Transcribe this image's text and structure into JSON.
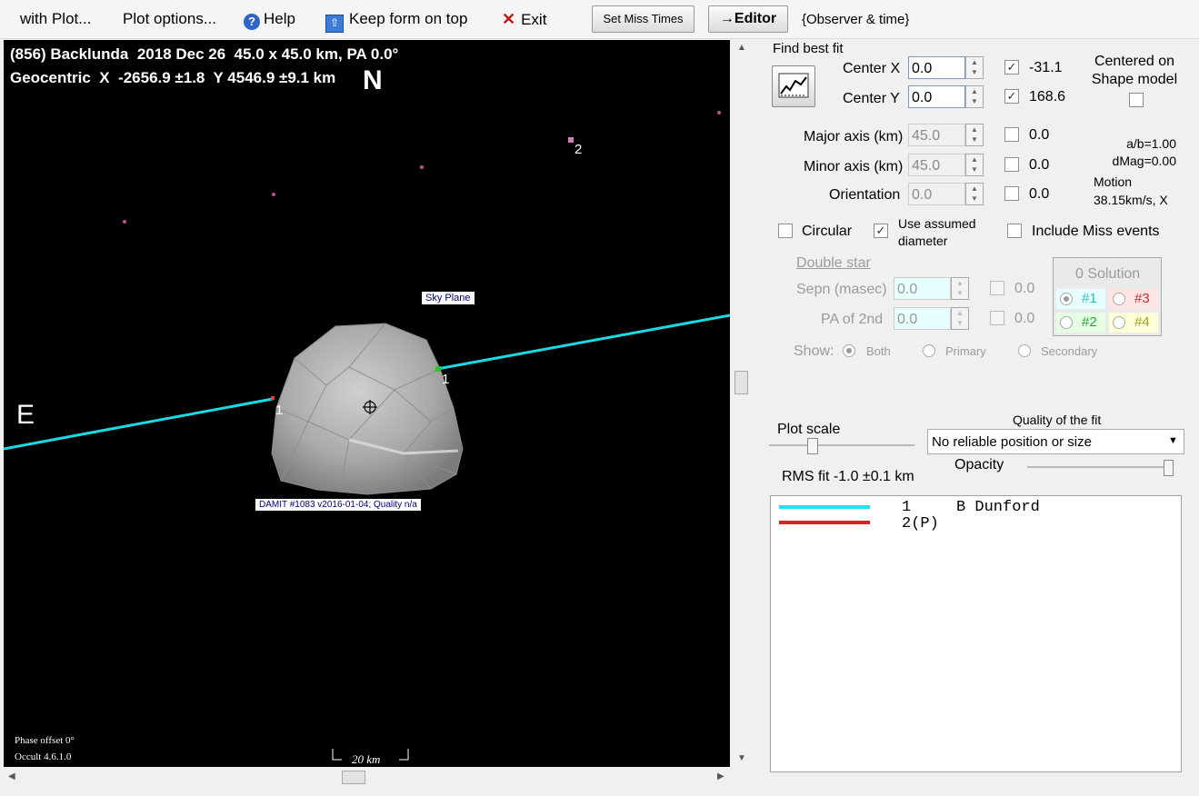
{
  "menu": {
    "with_plot": "with Plot...",
    "plot_options": "Plot options...",
    "help": "Help",
    "keep_form": "Keep form on top",
    "exit": "Exit",
    "set_miss_times": "Set Miss Times",
    "editor": "→Editor",
    "observer_time": "{Observer & time}"
  },
  "plot": {
    "title_line1": "(856) Backlunda  2018 Dec 26  45.0 x 45.0 km, PA 0.0°",
    "title_line2": "Geocentric  X  -2656.9 ±1.8  Y 4546.9 ±9.1 km",
    "north": "N",
    "east": "E",
    "sky_plane": "Sky Plane",
    "damit": "DAMIT #1083 v2016-01-04; Quality n/a",
    "chord_labels": [
      "1",
      "1",
      "2"
    ],
    "phase_offset": "Phase offset 0°",
    "version": "Occult 4.6.1.0",
    "scale_label": "20 km"
  },
  "fit": {
    "heading": "Find best fit",
    "center_x_label": "Center X",
    "center_x_value": "0.0",
    "center_x_result": "-31.1",
    "center_y_label": "Center Y",
    "center_y_value": "0.0",
    "center_y_result": "168.6",
    "major_label": "Major axis (km)",
    "major_value": "45.0",
    "major_result": "0.0",
    "minor_label": "Minor axis (km)",
    "minor_value": "45.0",
    "minor_result": "0.0",
    "orient_label": "Orientation",
    "orient_value": "0.0",
    "orient_result": "0.0",
    "centered_label": "Centered on Shape model",
    "ab": "a/b=1.00",
    "dmag": "dMag=0.00",
    "motion_label": "Motion",
    "motion_value": "38.15km/s, X",
    "circular": "Circular",
    "use_assumed": "Use assumed diameter",
    "include_miss": "Include Miss events"
  },
  "double_star": {
    "heading": "Double star",
    "sepn_label": "Sepn (masec)",
    "sepn_value": "0.0",
    "sepn_result": "0.0",
    "pa_label": "PA of 2nd",
    "pa_value": "0.0",
    "pa_result": "0.0",
    "show_label": "Show:",
    "both": "Both",
    "primary": "Primary",
    "secondary": "Secondary",
    "solution_heading": "0 Solution",
    "sol1": "#1",
    "sol2": "#2",
    "sol3": "#3",
    "sol4": "#4"
  },
  "bottom": {
    "plot_scale": "Plot scale",
    "quality_heading": "Quality of the fit",
    "quality_value": "No reliable position or size",
    "opacity": "Opacity",
    "rms": "RMS fit -1.0 ±0.1 km"
  },
  "legend": [
    {
      "num": "1",
      "name": "B Dunford",
      "color": "#22e4f0"
    },
    {
      "num": "2(P)",
      "name": "",
      "color": "#e02020"
    }
  ],
  "colors": {
    "chord": "#1ad9e3",
    "background": "#000000",
    "asteroid": "#a8a8a8"
  }
}
